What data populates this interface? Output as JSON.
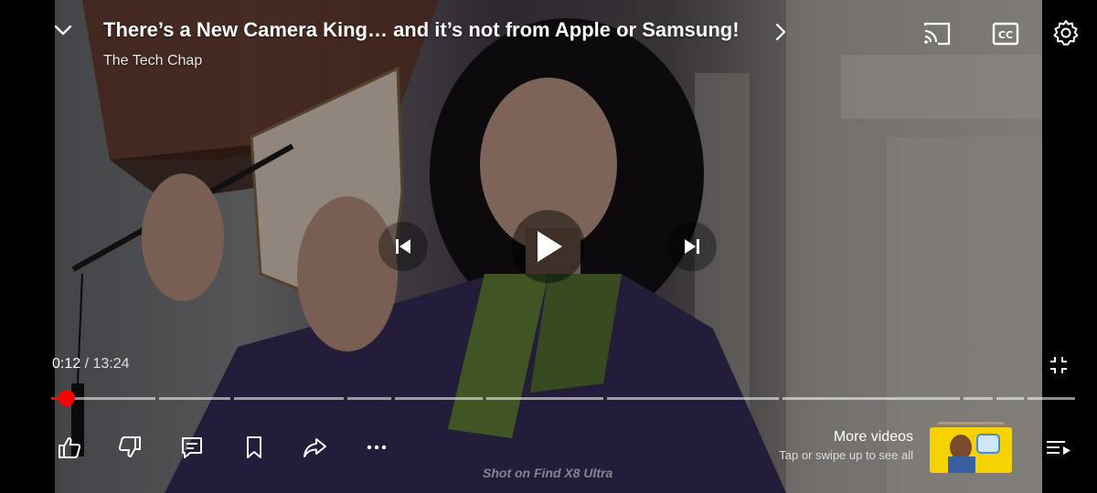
{
  "video": {
    "title": "There’s a New Camera King… and it’s not from Apple or Samsung!",
    "channel": "The Tech Chap",
    "current_time": "0:12",
    "separator": "/",
    "duration": "13:24",
    "progress_fraction": 0.015,
    "watermark": "Shot on Find X8 Ultra"
  },
  "icons": {
    "collapse": "chevron-down-icon",
    "title_more": "chevron-right-icon",
    "cast": "cast-icon",
    "captions": "closed-captions-icon",
    "settings": "gear-icon",
    "previous": "skip-previous-icon",
    "play": "play-icon",
    "next": "skip-next-icon",
    "exit_fullscreen": "exit-fullscreen-icon",
    "like": "thumbs-up-icon",
    "dislike": "thumbs-down-icon",
    "comments": "comment-icon",
    "save": "bookmark-icon",
    "share": "share-icon",
    "more": "more-horizontal-icon",
    "queue": "playlist-icon"
  },
  "more_videos": {
    "title": "More videos",
    "subtitle": "Tap or swipe up to see all"
  },
  "colors": {
    "progress_played": "#ff0000",
    "progress_track": "rgba(255,255,255,0.55)",
    "thumb_background": "#f6d200"
  }
}
